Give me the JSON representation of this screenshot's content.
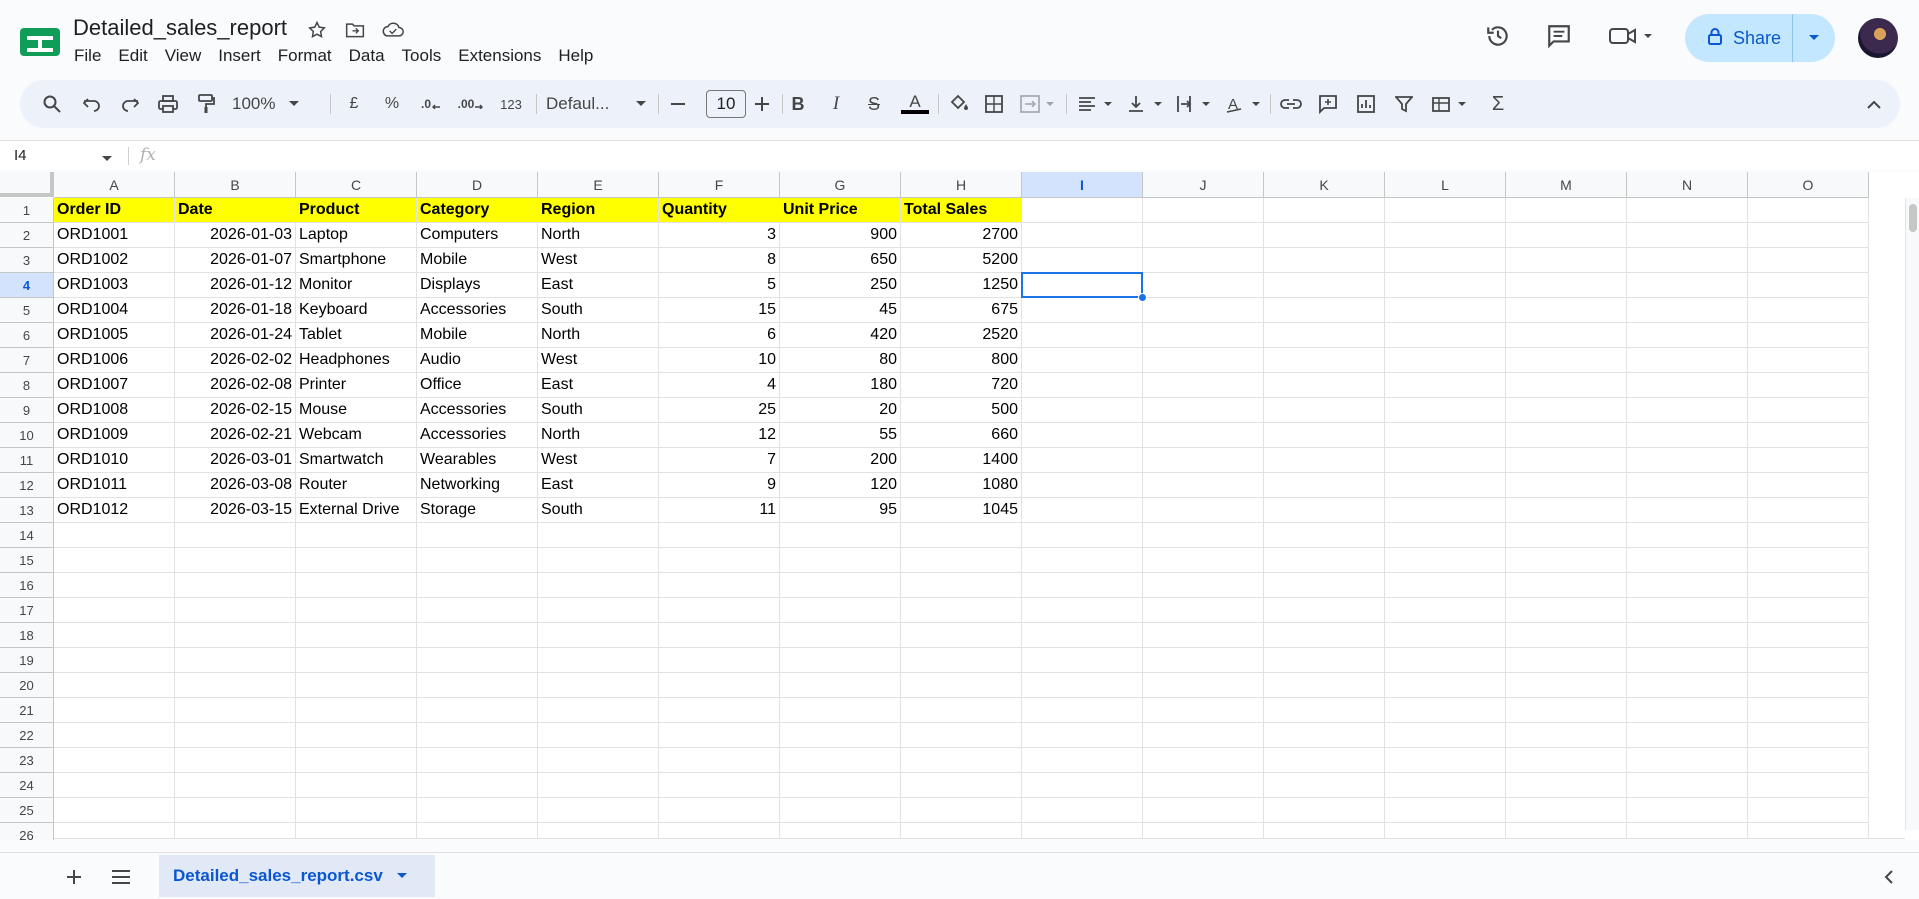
{
  "app": {
    "doc_title": "Detailed_sales_report",
    "menu": [
      "File",
      "Edit",
      "View",
      "Insert",
      "Format",
      "Data",
      "Tools",
      "Extensions",
      "Help"
    ],
    "share_label": "Share"
  },
  "toolbar": {
    "zoom": "100%",
    "currency": "£",
    "percent": "%",
    "decrease_decimal": ".0",
    "increase_decimal": ".00",
    "number_format": "123",
    "font": "Defaul...",
    "font_size": "10"
  },
  "formula_bar": {
    "name_box": "I4",
    "fx": "fx"
  },
  "grid": {
    "columns": [
      "A",
      "B",
      "C",
      "D",
      "E",
      "F",
      "G",
      "H",
      "I",
      "J",
      "K",
      "L",
      "M",
      "N",
      "O"
    ],
    "selected_column": "I",
    "selected_row": "4",
    "row_numbers": [
      "1",
      "2",
      "3",
      "4",
      "5",
      "6",
      "7",
      "8",
      "9",
      "10",
      "11",
      "12",
      "13",
      "14",
      "15",
      "16",
      "17",
      "18",
      "19",
      "20",
      "21",
      "22",
      "23",
      "24",
      "25",
      "26"
    ],
    "header": [
      "Order ID",
      "Date",
      "Product",
      "Category",
      "Region",
      "Quantity",
      "Unit Price",
      "Total Sales"
    ],
    "rows": [
      [
        "ORD1001",
        "2026-01-03",
        "Laptop",
        "Computers",
        "North",
        "3",
        "900",
        "2700"
      ],
      [
        "ORD1002",
        "2026-01-07",
        "Smartphone",
        "Mobile",
        "West",
        "8",
        "650",
        "5200"
      ],
      [
        "ORD1003",
        "2026-01-12",
        "Monitor",
        "Displays",
        "East",
        "5",
        "250",
        "1250"
      ],
      [
        "ORD1004",
        "2026-01-18",
        "Keyboard",
        "Accessories",
        "South",
        "15",
        "45",
        "675"
      ],
      [
        "ORD1005",
        "2026-01-24",
        "Tablet",
        "Mobile",
        "North",
        "6",
        "420",
        "2520"
      ],
      [
        "ORD1006",
        "2026-02-02",
        "Headphones",
        "Audio",
        "West",
        "10",
        "80",
        "800"
      ],
      [
        "ORD1007",
        "2026-02-08",
        "Printer",
        "Office",
        "East",
        "4",
        "180",
        "720"
      ],
      [
        "ORD1008",
        "2026-02-15",
        "Mouse",
        "Accessories",
        "South",
        "25",
        "20",
        "500"
      ],
      [
        "ORD1009",
        "2026-02-21",
        "Webcam",
        "Accessories",
        "North",
        "12",
        "55",
        "660"
      ],
      [
        "ORD1010",
        "2026-03-01",
        "Smartwatch",
        "Wearables",
        "West",
        "7",
        "200",
        "1400"
      ],
      [
        "ORD1011",
        "2026-03-08",
        "Router",
        "Networking",
        "East",
        "9",
        "120",
        "1080"
      ],
      [
        "ORD1012",
        "2026-03-15",
        "External Drive",
        "Storage",
        "South",
        "11",
        "95",
        "1045"
      ]
    ],
    "header_fill": "#ffff00",
    "selection_color": "#1a73e8"
  },
  "sheets": {
    "active": "Detailed_sales_report.csv"
  },
  "icons": [
    "sheets-logo-icon",
    "star-icon",
    "move-folder-icon",
    "cloud-saved-icon",
    "history-icon",
    "comment-icon",
    "meet-icon",
    "lock-icon",
    "avatar"
  ]
}
